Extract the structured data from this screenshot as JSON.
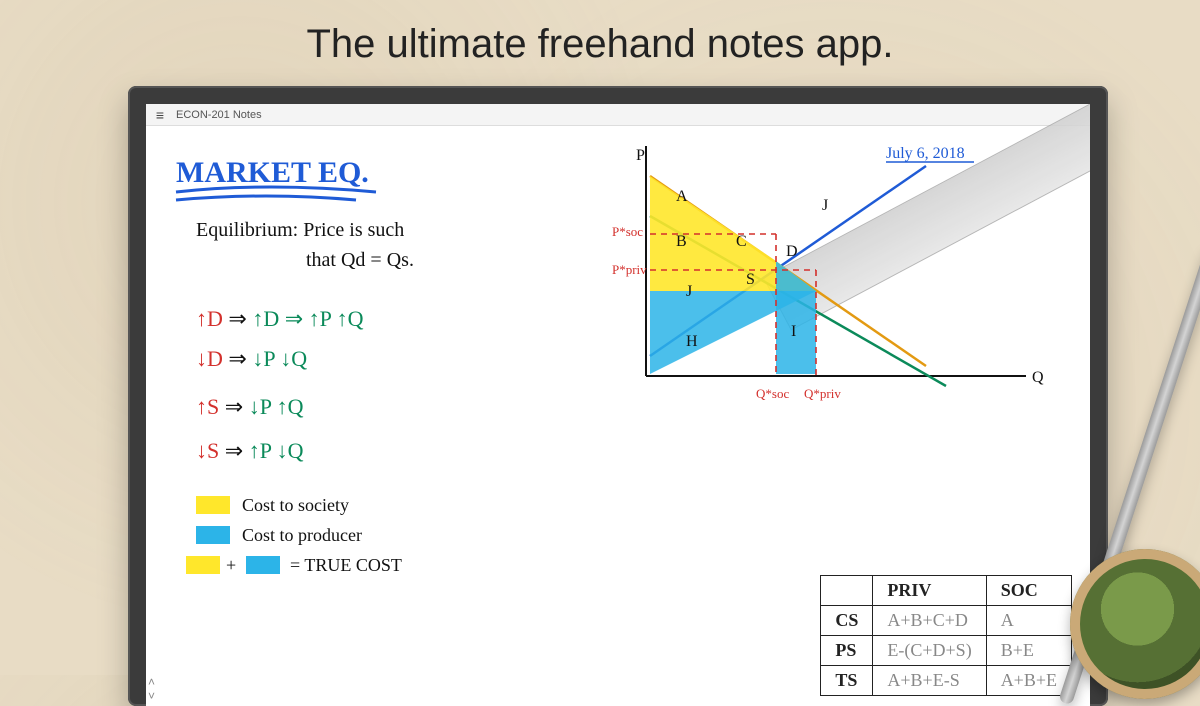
{
  "hero": {
    "title": "The ultimate freehand notes app."
  },
  "titlebar": {
    "document_title": "ECON-201 Notes"
  },
  "toolbar": {
    "tools": [
      {
        "name": "pen-blue",
        "glyph": "✒",
        "sel": true
      },
      {
        "name": "pen-red",
        "glyph": "✒",
        "sel": false
      },
      {
        "name": "pen-green",
        "glyph": "✒",
        "sel": false
      },
      {
        "name": "highlighter",
        "glyph": "◍",
        "sel": false
      },
      {
        "name": "eraser",
        "glyph": "◧",
        "sel": false
      },
      {
        "name": "lasso",
        "glyph": "◌",
        "sel": false
      },
      {
        "name": "undo",
        "glyph": "↶",
        "sel": false
      },
      {
        "name": "insert",
        "glyph": "⊞",
        "sel": false
      },
      {
        "name": "zoom",
        "glyph": "🔍",
        "sel": false
      },
      {
        "name": "more",
        "glyph": "⋯",
        "sel": false
      }
    ]
  },
  "notes": {
    "title": "MARKET EQ.",
    "date": "July 6, 2018",
    "def_line1": "Equilibrium:  Price is such",
    "def_line2": "that  Qd = Qs.",
    "rules": [
      "↑D  ⇒  ↑P  ↑Q",
      "↓D  ⇒  ↓P  ↓Q",
      "↑S  ⇒  ↓P  ↑Q",
      "↓S  ⇒  ↑P  ↓Q"
    ],
    "legend": {
      "a": "Cost to society",
      "b": "Cost to producer",
      "c": "= TRUE COST"
    },
    "axis": {
      "p_label": "P",
      "q_label": "Q",
      "p_soc": "P*soc",
      "p_priv": "P*priv",
      "q_soc": "Q*soc",
      "q_priv": "Q*priv",
      "regions": {
        "A": "A",
        "B": "B",
        "C": "C",
        "D": "D",
        "S": "S",
        "J": "J",
        "H": "H",
        "I": "I"
      }
    }
  },
  "table": {
    "cols": [
      "",
      "PRIV",
      "SOC"
    ],
    "rows": [
      {
        "label": "CS",
        "priv": "A+B+C+D",
        "soc": "A"
      },
      {
        "label": "PS",
        "priv": "E-(C+D+S)",
        "soc": "B+E"
      },
      {
        "label": "TS",
        "priv": "A+B+E-S",
        "soc": "A+B+E"
      }
    ]
  },
  "colors": {
    "blue": "#1f5bd6",
    "red": "#d3302c",
    "green": "#0b8a5a",
    "black": "#111",
    "yellow": "#ffe72b",
    "cyan": "#2cb4e8",
    "gray": "#888"
  }
}
